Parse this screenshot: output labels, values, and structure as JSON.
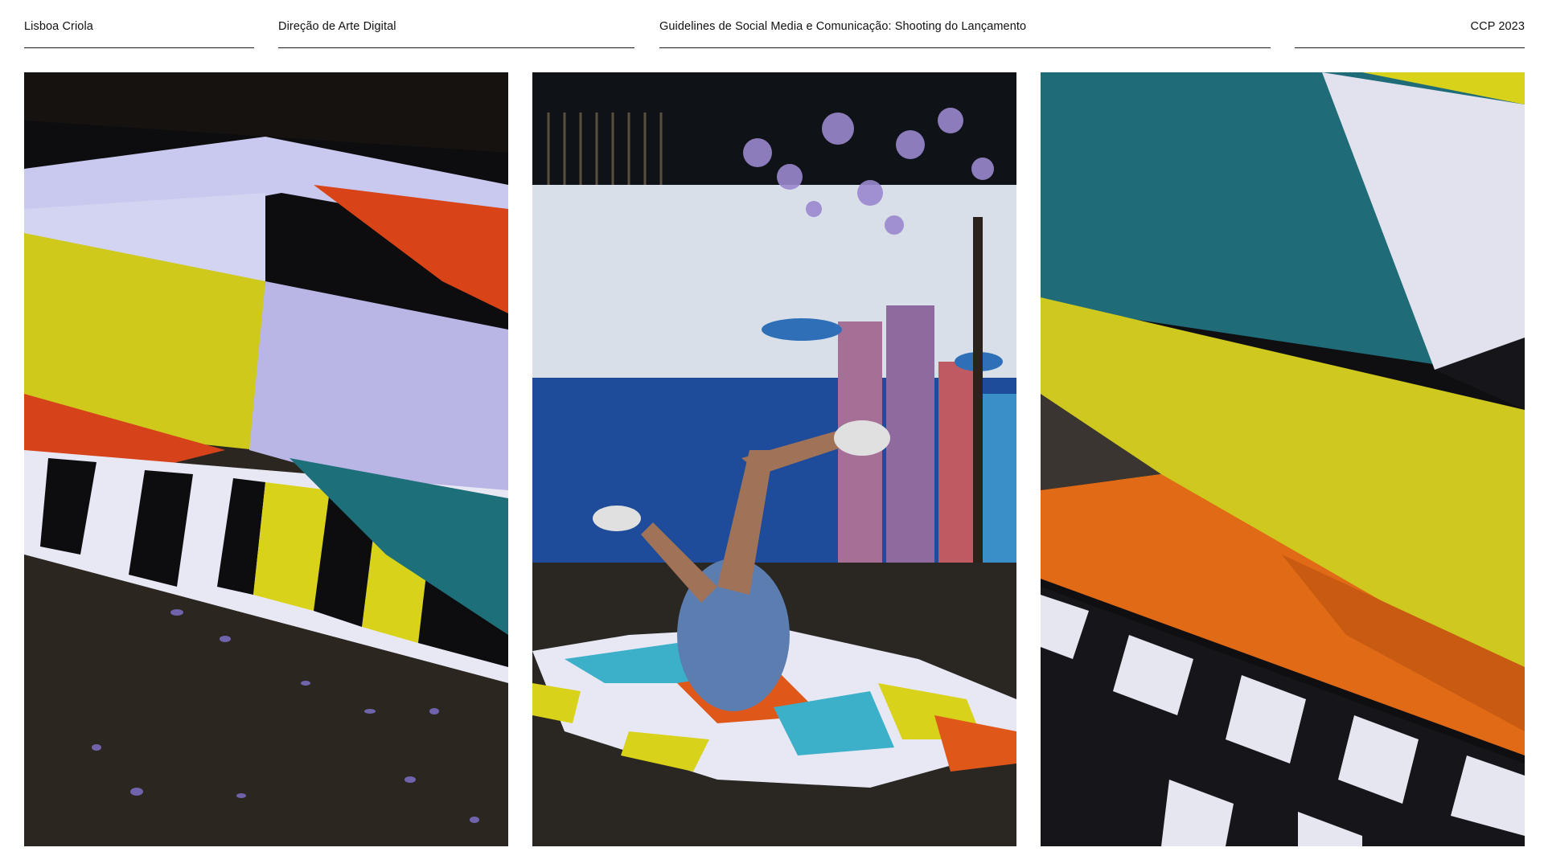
{
  "header": {
    "left": "Lisboa Criola",
    "section": "Direção de Arte Digital",
    "title": "Guidelines de Social Media e Comunicação: Shooting do Lançamento",
    "right": "CCP 2023"
  },
  "photos": [
    {
      "subject": "colorful fabric on asphalt with purple petals"
    },
    {
      "subject": "dancer doing a freeze on patterned fabric in front of mural wall"
    },
    {
      "subject": "close-up of colorful geometric fabric"
    }
  ],
  "colors": {
    "fabric_yellow": "#d9d21a",
    "fabric_teal": "#1d6f7a",
    "fabric_orange": "#e0571a",
    "fabric_lavender": "#b9b6e6",
    "fabric_black": "#0d0d10",
    "asphalt": "#2b2620",
    "wall_blue": "#1f4c9a",
    "tile_white": "#d9dfe8"
  }
}
